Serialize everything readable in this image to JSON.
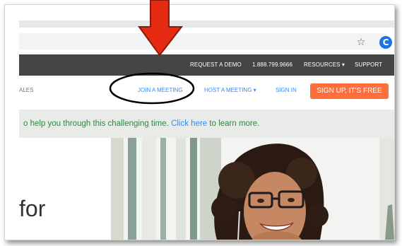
{
  "browser": {
    "bookmark_icon": "star-icon",
    "extension_icon": "chrome-extension-icon",
    "extension_glyph": "C"
  },
  "top_nav": {
    "request_demo": "REQUEST A DEMO",
    "phone": "1.888.799.9666",
    "resources": "RESOURCES ▾",
    "support": "SUPPORT"
  },
  "main_nav": {
    "left_item": "ALES",
    "join_meeting": "JOIN A MEETING",
    "host_meeting": "HOST A MEETING ▾",
    "sign_in": "SIGN IN",
    "sign_up": "SIGN UP, IT'S FREE"
  },
  "banner": {
    "text_before": "o help you through this challenging time.",
    "link": "Click here",
    "text_after": "to learn more."
  },
  "hero": {
    "headline_fragment": "for"
  },
  "annotations": {
    "arrow_color": "#e52b12",
    "circle_color": "#000000"
  },
  "colors": {
    "top_nav_bg": "#454545",
    "accent_blue": "#2d8cff",
    "signup_orange": "#ff6f3c",
    "banner_green": "#2b8a3e"
  }
}
